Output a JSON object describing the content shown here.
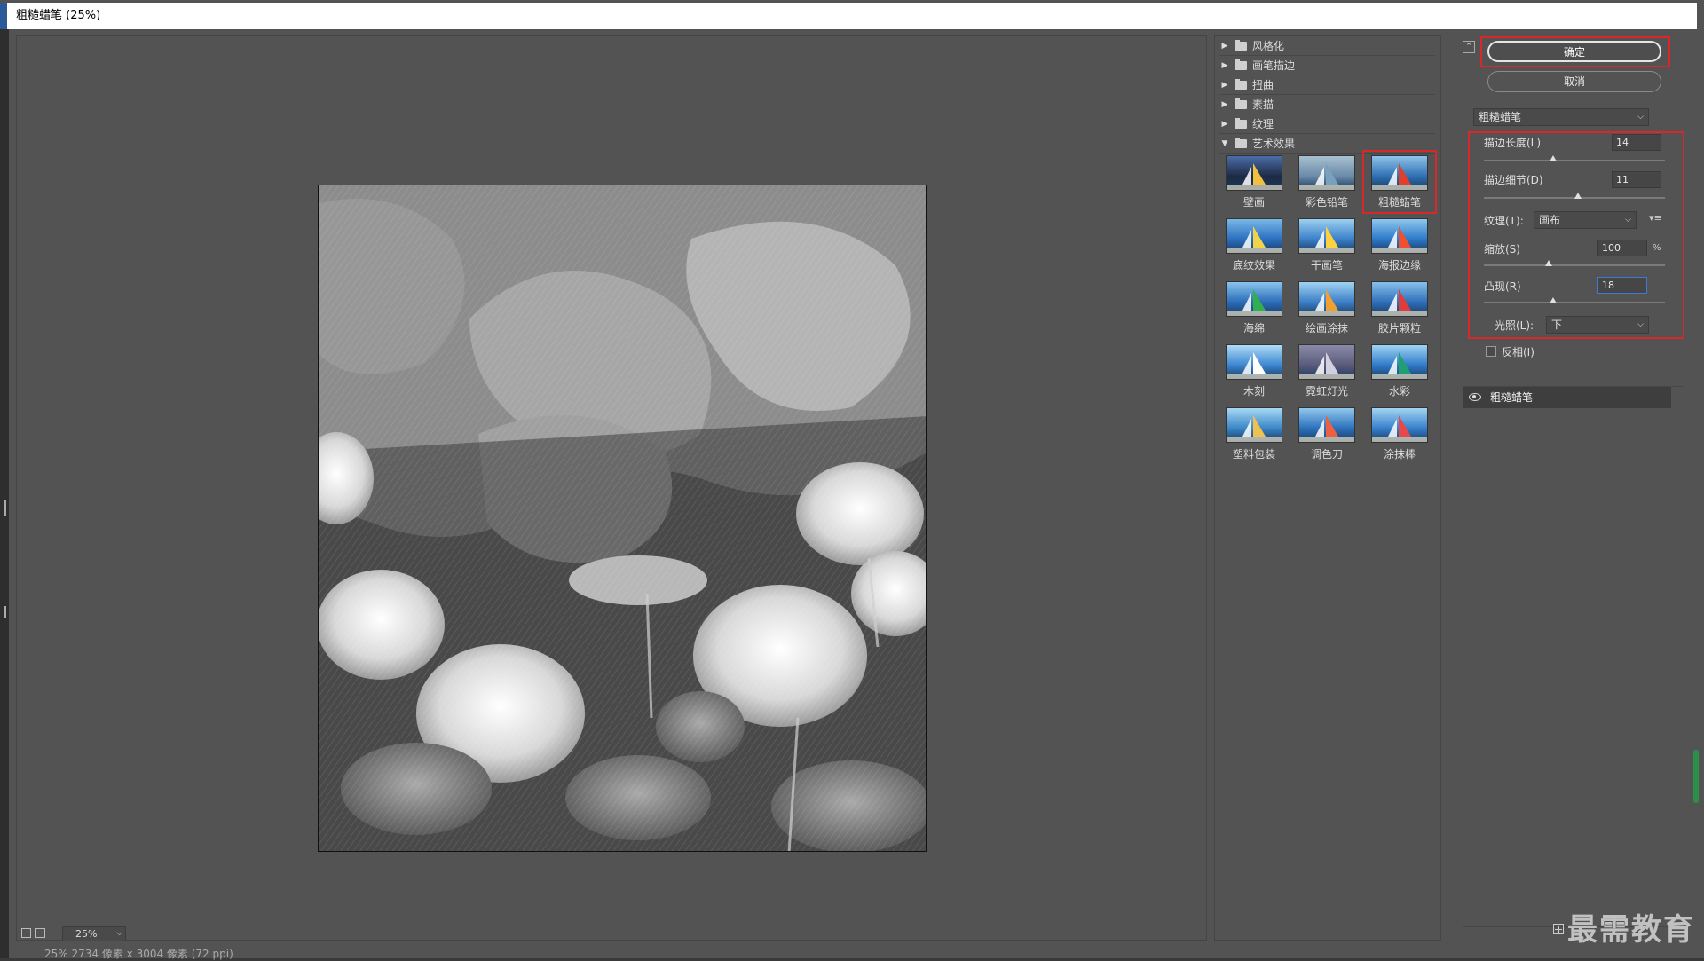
{
  "window": {
    "title": "粗糙蜡笔 (25%)"
  },
  "preview": {
    "zoom": "25%",
    "info": "25% 2734 像素 x 3004 像素 (72 ppi)"
  },
  "gallery": {
    "folders": [
      {
        "label": "风格化",
        "expanded": false
      },
      {
        "label": "画笔描边",
        "expanded": false
      },
      {
        "label": "扭曲",
        "expanded": false
      },
      {
        "label": "素描",
        "expanded": false
      },
      {
        "label": "纹理",
        "expanded": false
      },
      {
        "label": "艺术效果",
        "expanded": true
      }
    ],
    "filters": [
      "壁画",
      "彩色铅笔",
      "粗糙蜡笔",
      "底纹效果",
      "干画笔",
      "海报边缘",
      "海绵",
      "绘画涂抹",
      "胶片颗粒",
      "木刻",
      "霓虹灯光",
      "水彩",
      "塑料包装",
      "调色刀",
      "涂抹棒"
    ],
    "selected": "粗糙蜡笔"
  },
  "controls": {
    "ok_label": "确定",
    "cancel_label": "取消",
    "filter_select": "粗糙蜡笔",
    "stroke_length": {
      "label": "描边长度(L)",
      "value": "14",
      "fraction": 0.38
    },
    "stroke_detail": {
      "label": "描边细节(D)",
      "value": "11",
      "fraction": 0.52
    },
    "texture": {
      "label": "纹理(T):",
      "value": "画布"
    },
    "scaling": {
      "label": "缩放(S)",
      "value": "100",
      "unit": "%",
      "fraction": 0.36
    },
    "relief": {
      "label": "凸现(R)",
      "value": "18",
      "fraction": 0.38
    },
    "light": {
      "label": "光照(L):",
      "value": "下"
    },
    "invert": {
      "label": "反相(I)",
      "checked": false
    }
  },
  "layers": {
    "item": "粗糙蜡笔"
  },
  "watermark": "最需教育",
  "colors": {
    "highlight_red": "#d8282a",
    "panel": "#535353"
  }
}
